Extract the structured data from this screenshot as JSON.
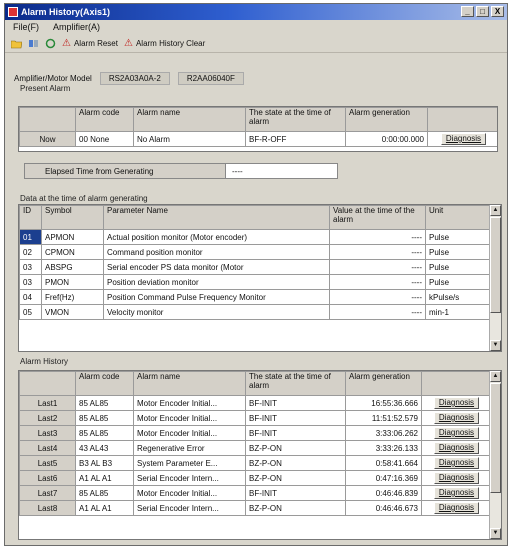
{
  "window": {
    "title": "Alarm History(Axis1)",
    "buttons": [
      "_",
      "□",
      "X"
    ]
  },
  "menu": [
    "File(F)",
    "Amplifier(A)"
  ],
  "toolbar": {
    "alarm_reset": "Alarm Reset",
    "history_clear": "Alarm History Clear"
  },
  "model": {
    "label": "Amplifier/Motor Model",
    "amp": "RS2A03A0A-2",
    "motor": "R2AA06040F"
  },
  "present": {
    "group_label": "Present Alarm",
    "headers": [
      "Alarm code",
      "Alarm name",
      "The state at the time of alarm",
      "Alarm generation"
    ],
    "row": {
      "label": "Now",
      "code": "00 None",
      "name": "No Alarm",
      "state": "BF-R-OFF",
      "time": "0:00:00.000",
      "button": "Diagnosis"
    }
  },
  "elapsed": {
    "label": "Elapsed Time from Generating",
    "value": "----"
  },
  "status": {
    "group_label": "Data at the time of alarm generating",
    "headers": [
      "ID",
      "Symbol",
      "Parameter Name",
      "Value at the time of the alarm",
      "Unit"
    ],
    "rows": [
      {
        "id": "01",
        "symbol": "APMON",
        "name": "Actual position monitor (Motor encoder)",
        "value": "----",
        "unit": "Pulse"
      },
      {
        "id": "02",
        "symbol": "CPMON",
        "name": "Command position monitor",
        "value": "----",
        "unit": "Pulse"
      },
      {
        "id": "03",
        "symbol": "ABSPG",
        "name": "Serial encoder PS data monitor (Motor",
        "value": "----",
        "unit": "Pulse"
      },
      {
        "id": "03",
        "symbol": "PMON",
        "name": "Position deviation monitor",
        "value": "----",
        "unit": "Pulse"
      },
      {
        "id": "04",
        "symbol": "Fref(Hz)",
        "name": "Position Command Pulse Frequency Monitor",
        "value": "----",
        "unit": "kPulse/s"
      },
      {
        "id": "05",
        "symbol": "VMON",
        "name": "Velocity monitor",
        "value": "----",
        "unit": "min-1"
      }
    ]
  },
  "history": {
    "group_label": "Alarm History",
    "headers": [
      "Alarm code",
      "Alarm name",
      "The state at the time of alarm",
      "Alarm generation"
    ],
    "rows": [
      {
        "label": "Last1",
        "code": "85 AL85",
        "name": "Motor Encoder Initial...",
        "state": "BF-INIT",
        "time": "16:55:36.666",
        "button": "Diagnosis"
      },
      {
        "label": "Last2",
        "code": "85 AL85",
        "name": "Motor Encoder Initial...",
        "state": "BF-INIT",
        "time": "11:51:52.579",
        "button": "Diagnosis"
      },
      {
        "label": "Last3",
        "code": "85 AL85",
        "name": "Motor Encoder Initial...",
        "state": "BF-INIT",
        "time": "3:33:06.262",
        "button": "Diagnosis"
      },
      {
        "label": "Last4",
        "code": "43 AL43",
        "name": "Regenerative Error",
        "state": "BZ-P-ON",
        "time": "3:33:26.133",
        "button": "Diagnosis"
      },
      {
        "label": "Last5",
        "code": "B3 AL B3",
        "name": "System Parameter E...",
        "state": "BZ-P-ON",
        "time": "0:58:41.664",
        "button": "Diagnosis"
      },
      {
        "label": "Last6",
        "code": "A1 AL A1",
        "name": "Serial Encoder Intern...",
        "state": "BZ-P-ON",
        "time": "0:47:16.369",
        "button": "Diagnosis"
      },
      {
        "label": "Last7",
        "code": "85 AL85",
        "name": "Motor Encoder Initial...",
        "state": "BF-INIT",
        "time": "0:46:46.839",
        "button": "Diagnosis"
      },
      {
        "label": "Last8",
        "code": "A1 AL A1",
        "name": "Serial Encoder Intern...",
        "state": "BZ-P-ON",
        "time": "0:46:46.673",
        "button": "Diagnosis"
      }
    ]
  }
}
